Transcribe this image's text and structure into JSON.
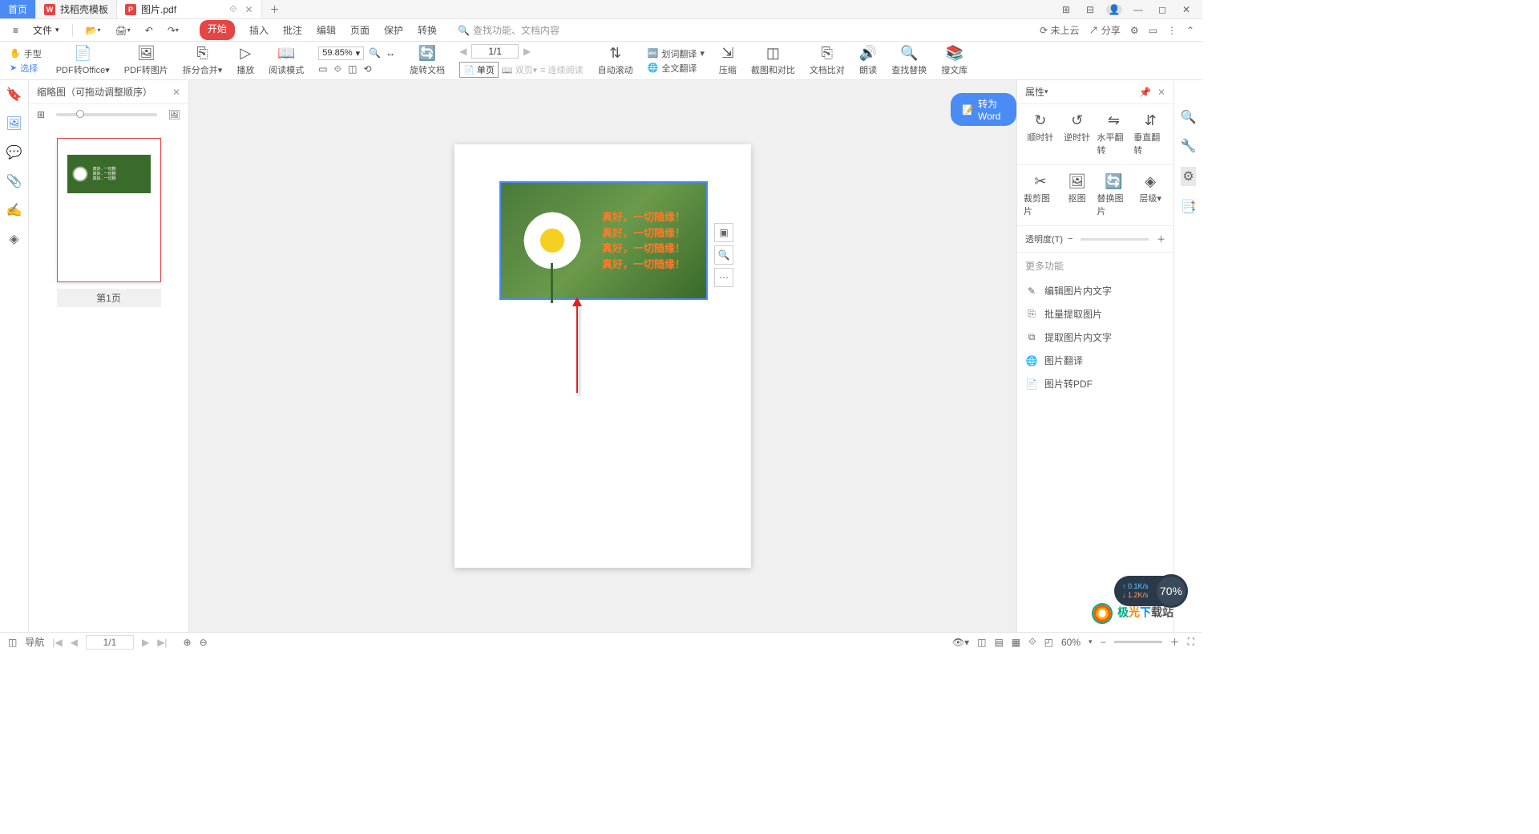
{
  "titlebar": {
    "home_label": "首页",
    "tabs": [
      {
        "label": "找稻壳模板",
        "icon_color": "#e64545"
      },
      {
        "label": "图片.pdf",
        "icon_color": "#e64545"
      }
    ],
    "win_icons": {
      "layout": "⊞",
      "grid": "⊟",
      "user": "👤",
      "min": "—",
      "max": "◻",
      "close": "✕"
    }
  },
  "menubar": {
    "file": "文件",
    "tools": {
      "open": "📂",
      "save": "💾",
      "print": "🖨",
      "undo": "↶",
      "redo": "↷"
    },
    "tabs": [
      "开始",
      "插入",
      "批注",
      "编辑",
      "页面",
      "保护",
      "转换"
    ],
    "active_tab_index": 0,
    "search_placeholder": "查找功能、文档内容",
    "right": {
      "cloud": "未上云",
      "share": "分享",
      "settings": "⚙",
      "present": "▭",
      "more": "⋮",
      "expand": "⌃"
    }
  },
  "cursor_modes": {
    "hand": "手型",
    "select": "选择"
  },
  "ribbon": {
    "pdf_to_office": "PDF转Office",
    "pdf_to_image": "PDF转图片",
    "split_merge": "拆分合并",
    "play": "播放",
    "read_mode": "阅读模式",
    "zoom_value": "59.85%",
    "page_indicator": "1/1",
    "rotate_doc": "旋转文档",
    "single_page": "单页",
    "double_page": "双页",
    "continuous": "连续阅读",
    "auto_scroll": "自动滚动",
    "word_translate": "划词翻译",
    "full_translate": "全文翻译",
    "compress": "压缩",
    "screenshot_compare": "截图和对比",
    "text_compare": "文档比对",
    "read_aloud": "朗读",
    "find_replace": "查找替换",
    "search_lib": "搜文库"
  },
  "thumb_panel": {
    "title": "缩略图（可拖动调整顺序）",
    "page_label": "第1页"
  },
  "doc_image_text": [
    "真好，一切随缘！",
    "真好，一切随缘！",
    "真好，一切随缘！",
    "真好，一切随缘！"
  ],
  "convert_button": "转为Word",
  "float_tools": {
    "fit": "▣",
    "zoom": "🔍",
    "more": "⋯"
  },
  "props_panel": {
    "title": "属性",
    "rotate_cw": "顺时针",
    "rotate_ccw": "逆时针",
    "flip_h": "水平翻转",
    "flip_v": "垂直翻转",
    "crop": "裁剪图片",
    "cutout": "抠图",
    "replace": "替换图片",
    "layer": "层级",
    "opacity_label": "透明度(T)",
    "more_title": "更多功能",
    "more_items": [
      {
        "icon": "✎",
        "label": "编辑图片内文字"
      },
      {
        "icon": "⎘",
        "label": "批量提取图片"
      },
      {
        "icon": "⧉",
        "label": "提取图片内文字"
      },
      {
        "icon": "🌐",
        "label": "图片翻译"
      },
      {
        "icon": "📄",
        "label": "图片转PDF"
      }
    ]
  },
  "statusbar": {
    "nav": "导航",
    "page": "1/1",
    "zoom": "60%"
  },
  "net_widget": {
    "up": "0.1K/s",
    "down": "1.2K/s",
    "percent": "70%"
  },
  "brand_text": "极光下载站"
}
